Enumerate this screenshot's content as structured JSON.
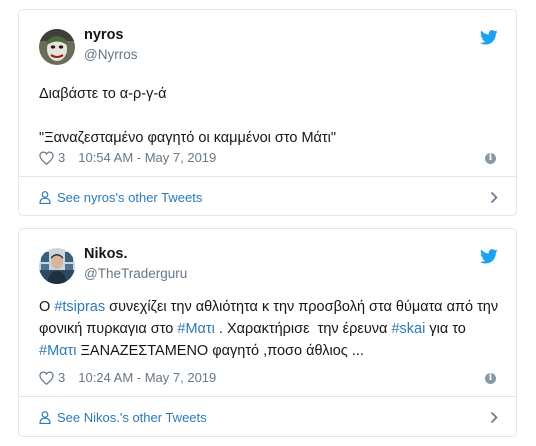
{
  "tweets": [
    {
      "name": "nyros",
      "handle": "@Nyrros",
      "text_lines": [
        "Διαβάστε το α-ρ-γ-ά",
        "",
        "\"Ξαναζεσταμένο φαγητό οι καμμένοι στο Μάτι\""
      ],
      "likes": "3",
      "timestamp": "10:54 AM - May 7, 2019",
      "footer_link": "See nyros's other Tweets"
    },
    {
      "name": "Nikos.",
      "handle": "@TheTraderguru",
      "text_parts": {
        "p1": "Ο ",
        "h1": "#tsipras",
        "p2": " συνεχίζει την αθλιότητα κ την προσβολή στα θύματα από την φονική πυρκαγια στο ",
        "h2": "#Ματι",
        "p3": " . Χαρακτήρισε  την έρευνα ",
        "h3": "#skai",
        "p4": " για το ",
        "h4": "#Ματι",
        "p5": " ΞΑΝΑΖΕΣΤΑΜΕΝΟ φαγητό ,ποσο άθλιος ..."
      },
      "likes": "3",
      "timestamp": "10:24 AM - May 7, 2019",
      "footer_link": "See Nikos.'s other Tweets"
    }
  ],
  "colors": {
    "link": "#2b7bb9",
    "twitter_blue": "#1da1f2",
    "muted": "#657786",
    "border": "#e1e8ed"
  },
  "icons": [
    "twitter-bird-icon",
    "heart-icon",
    "info-icon",
    "person-icon",
    "chevron-right-icon"
  ]
}
